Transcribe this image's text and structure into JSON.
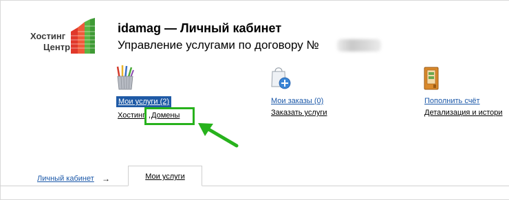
{
  "logo": {
    "line1": "Хостинг",
    "line2": "Центр"
  },
  "header": {
    "title": "idamag — Личный кабинет",
    "subtitle": "Управление услугами по договору №"
  },
  "blocks": {
    "services": {
      "main_link": "Мои услуги (2)",
      "sub_a": "Хостинг",
      "sub_sep": ",",
      "sub_b": "Домены"
    },
    "orders": {
      "main_link": "Мои заказы (0)",
      "sub": "Заказать услуги"
    },
    "balance": {
      "main_link": "Пополнить счёт",
      "sub": "Детализация и истори"
    }
  },
  "nav": {
    "breadcrumb": "Личный кабинет",
    "arrow": "→",
    "active_tab": "Мои услуги"
  },
  "colors": {
    "link": "#1a57a8",
    "highlight": "#1f5aa6",
    "annotation": "#27b21c"
  }
}
